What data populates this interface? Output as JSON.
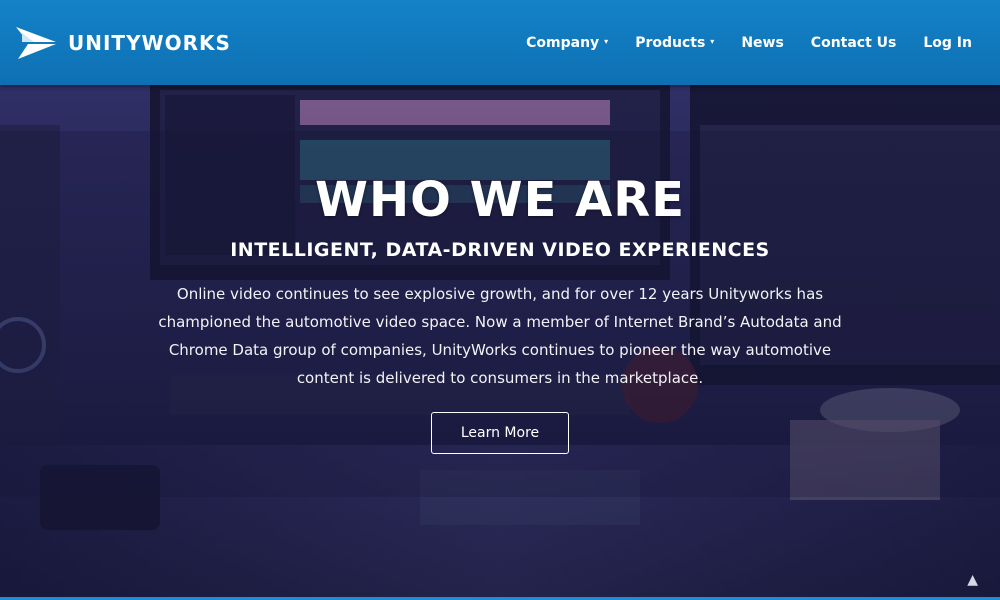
{
  "brand": {
    "name": "UNITYWORKS",
    "logo_icon": "unityworks-wing-logo"
  },
  "nav": {
    "items": [
      {
        "label": "Company",
        "has_dropdown": true
      },
      {
        "label": "Products",
        "has_dropdown": true
      },
      {
        "label": "News",
        "has_dropdown": false
      },
      {
        "label": "Contact Us",
        "has_dropdown": false
      },
      {
        "label": "Log In",
        "has_dropdown": false
      }
    ],
    "caret_glyph": "▾"
  },
  "hero": {
    "title": "WHO WE ARE",
    "subtitle": "INTELLIGENT, DATA-DRIVEN VIDEO EXPERIENCES",
    "body": "Online video continues to see explosive growth, and for over 12 years Unityworks has championed the automotive video space. Now a member of Internet Brand’s Autodata and Chrome Data group of companies, UnityWorks continues to pioneer the way automotive content is delivered to consumers in the marketplace.",
    "button_label": "Learn More",
    "scroll_top_glyph": "▲"
  },
  "colors": {
    "header_blue": "#1482c8",
    "hero_tint": "#252550",
    "accent_line": "#1a8fd8",
    "text": "#ffffff"
  }
}
